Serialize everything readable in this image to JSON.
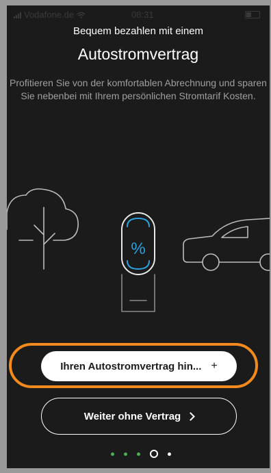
{
  "status_bar": {
    "carrier": "Vodafone.de",
    "time": "08:31",
    "icons": [
      "signal-icon",
      "wifi-icon",
      "battery-icon"
    ]
  },
  "onboarding": {
    "subtitle": "Bequem bezahlen mit einem",
    "title": "Autostromvertrag",
    "description": "Profitieren Sie von der komfortablen Abrechnung und sparen Sie nebenbei mit Ihrem persönlichen Stromtarif Kosten.",
    "illustration": {
      "icons": [
        "tree-icon",
        "percent-battery-icon",
        "car-icon"
      ],
      "percent_symbol": "%"
    }
  },
  "actions": {
    "primary_label": "Ihren Autostromvertrag hin...",
    "primary_icon": "+",
    "secondary_label": "Weiter ohne Vertrag"
  },
  "pagination": {
    "total": 5,
    "current": 4
  },
  "colors": {
    "background": "#1b1b1b",
    "highlight": "#f28a1e",
    "accent_blue": "#2aa3e0",
    "dot_green": "#4caf50",
    "frame": "#9a9a9a"
  }
}
